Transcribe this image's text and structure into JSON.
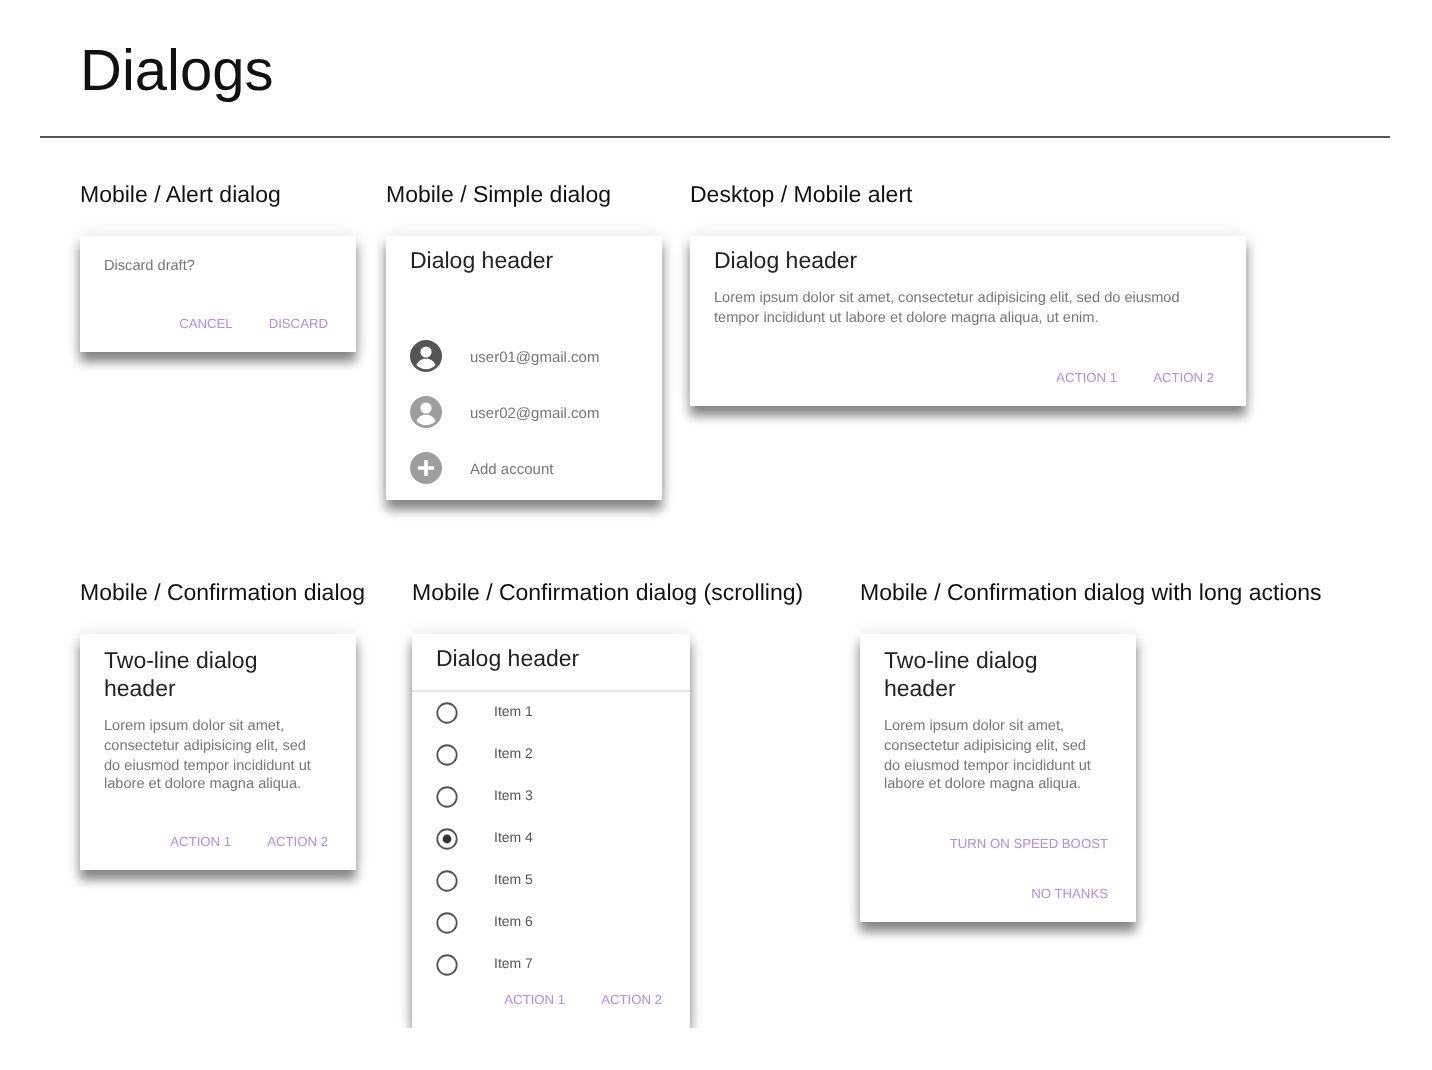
{
  "title": "Dialogs",
  "rows": [
    {
      "dialogs": [
        {
          "kind": "alert",
          "label": "Mobile / Alert dialog",
          "body": "Discard draft?",
          "actions": [
            "CANCEL",
            "DISCARD"
          ]
        },
        {
          "kind": "simple",
          "label": "Mobile / Simple dialog",
          "header": "Dialog header",
          "items": [
            {
              "kind": "account",
              "text": "user01@gmail.com",
              "color": "#555555"
            },
            {
              "kind": "account",
              "text": "user02@gmail.com",
              "color": "#9e9e9e"
            },
            {
              "kind": "add",
              "text": "Add account",
              "color": "#9e9e9e"
            }
          ]
        },
        {
          "kind": "desktop",
          "label": "Desktop / Mobile alert",
          "header": "Dialog header",
          "body": "Lorem ipsum dolor sit amet, consectetur adipisicing elit, sed do eiusmod tempor incididunt ut labore et dolore magna aliqua, ut enim.",
          "actions": [
            "ACTION 1",
            "ACTION 2"
          ]
        }
      ]
    },
    {
      "dialogs": [
        {
          "kind": "confirmation",
          "label": "Mobile / Confirmation dialog",
          "header": "Two-line dialog header",
          "body": "Lorem ipsum dolor sit amet, consectetur adipisicing elit, sed do eiusmod tempor incididunt ut labore et dolore magna aliqua.",
          "actions": [
            "ACTION 1",
            "ACTION 2"
          ]
        },
        {
          "kind": "scrolling",
          "label": "Mobile / Confirmation dialog (scrolling)",
          "header": "Dialog header",
          "options": [
            {
              "text": "Item 1",
              "selected": false
            },
            {
              "text": "Item 2",
              "selected": false
            },
            {
              "text": "Item 3",
              "selected": false
            },
            {
              "text": "Item 4",
              "selected": true
            },
            {
              "text": "Item 5",
              "selected": false
            },
            {
              "text": "Item 6",
              "selected": false
            },
            {
              "text": "Item 7",
              "selected": false
            }
          ],
          "actions": [
            "ACTION 1",
            "ACTION 2"
          ]
        },
        {
          "kind": "long_actions",
          "label": "Mobile / Confirmation dialog with long actions",
          "header": "Two-line dialog header",
          "body": "Lorem ipsum dolor sit amet, consectetur adipisicing elit, sed do eiusmod tempor incididunt ut labore et dolore magna aliqua.",
          "actions": [
            "TURN ON SPEED BOOST",
            "NO THANKS"
          ]
        }
      ]
    }
  ]
}
